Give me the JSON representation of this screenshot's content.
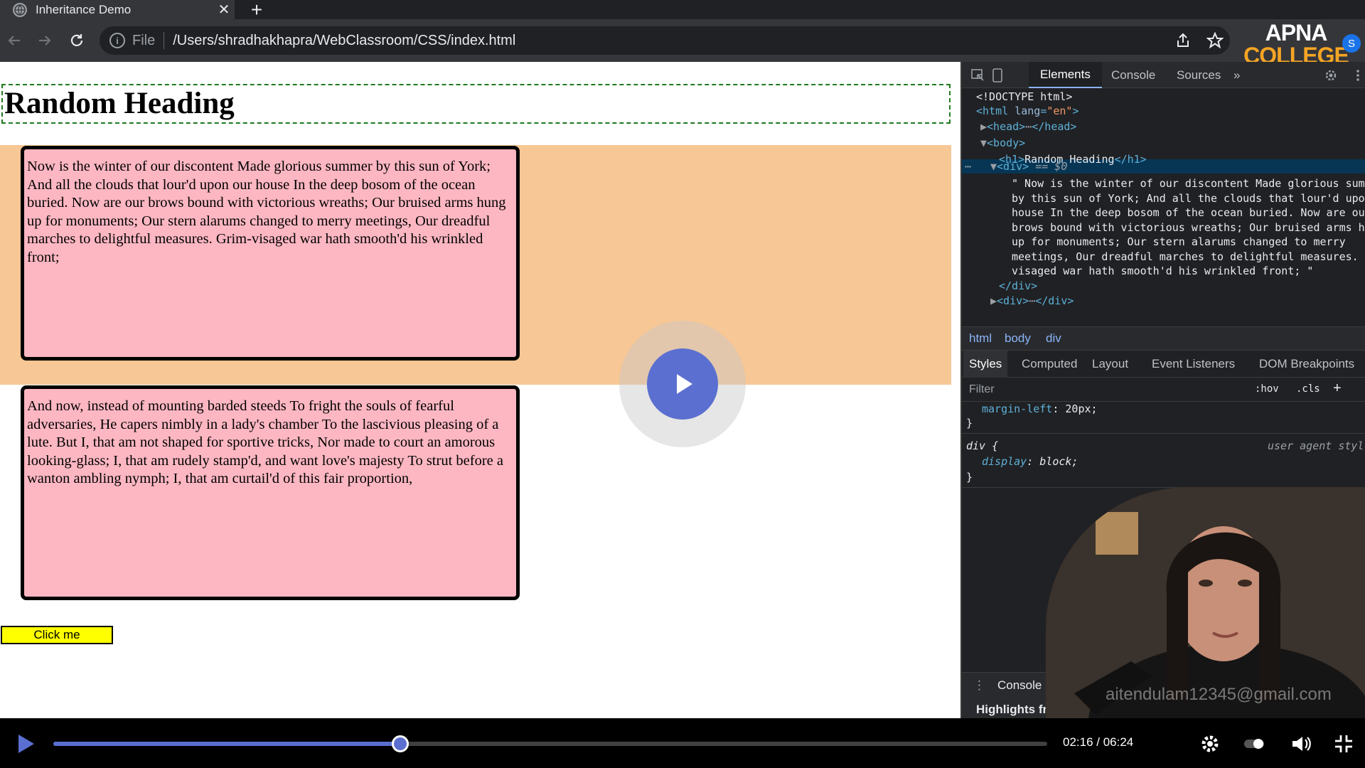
{
  "browser": {
    "tab_title": "Inheritance Demo",
    "tab_close": "✕",
    "new_tab": "+",
    "scheme": "File",
    "url": "/Users/shradhakhapra/WebClassroom/CSS/index.html",
    "profile_initial": "S"
  },
  "watermark": {
    "logo_line1": "APNA",
    "logo_line2": "COLLEGE",
    "email": "aitendulam12345@gmail.com"
  },
  "page": {
    "heading": "Random Heading",
    "para1": "Now is the winter of our discontent Made glorious summer by this sun of York; And all the clouds that lour'd upon our house In the deep bosom of the ocean buried. Now are our brows bound with victorious wreaths; Our bruised arms hung up for monuments; Our stern alarums changed to merry meetings, Our dreadful marches to delightful measures. Grim-visaged war hath smooth'd his wrinkled front;",
    "para2": "And now, instead of mounting barded steeds To fright the souls of fearful adversaries, He capers nimbly in a lady's chamber To the lascivious pleasing of a lute. But I, that am not shaped for sportive tricks, Nor made to court an amorous looking-glass; I, that am rudely stamp'd, and want love's majesty To strut before a wanton ambling nymph; I, that am curtail'd of this fair proportion,",
    "button": "Click me"
  },
  "devtools": {
    "tabs": [
      "Elements",
      "Console",
      "Sources",
      "»"
    ],
    "dom_lines": {
      "doctype": "<!DOCTYPE html>",
      "html_open_tag": "<html",
      "html_attr": "lang",
      "html_attr_val": "\"en\"",
      "head": "<head>",
      "head_close": "</head>",
      "body": "<body>",
      "h1_open": "<h1>",
      "h1_text": "Random Heading",
      "h1_close": "</h1>",
      "div_open": "<div>",
      "selected_marker": "== $0",
      "text1": "\" Now is the winter of our discontent Made glorious sum",
      "text2": "by this sun of York; And all the clouds that lour'd upo",
      "text3": "house In the deep bosom of the ocean buried. Now are ou",
      "text4": "brows bound with victorious wreaths; Our bruised arms h",
      "text5": "up for monuments; Our stern alarums changed to merry",
      "text6": "meetings, Our dreadful marches to delightful measures.",
      "text7": "visaged war hath smooth'd his wrinkled front; \"",
      "div_close": "</div>",
      "div2_open": "<div>",
      "div2_close": "</div>"
    },
    "breadcrumbs": [
      "html",
      "body",
      "div"
    ],
    "style_tabs": [
      "Styles",
      "Computed",
      "Layout",
      "Event Listeners",
      "DOM Breakpoints"
    ],
    "filter_placeholder": "Filter",
    "hov": ":hov",
    "cls": ".cls",
    "rule1_prop": "margin-left",
    "rule1_val": "20px;",
    "rule2_selector": "div {",
    "rule2_source": "user agent styl",
    "rule2_prop": "display",
    "rule2_val": "block;",
    "close_brace": "}",
    "drawer_console": "Console",
    "drawer_highlights": "Highlights fror"
  },
  "player": {
    "progress": 0.3489,
    "time": "02:16 / 06:24"
  },
  "colors": {
    "accent": "#5b6fd0",
    "band": "#f7c795",
    "box": "#fdb7c2",
    "button": "#ffff00"
  }
}
